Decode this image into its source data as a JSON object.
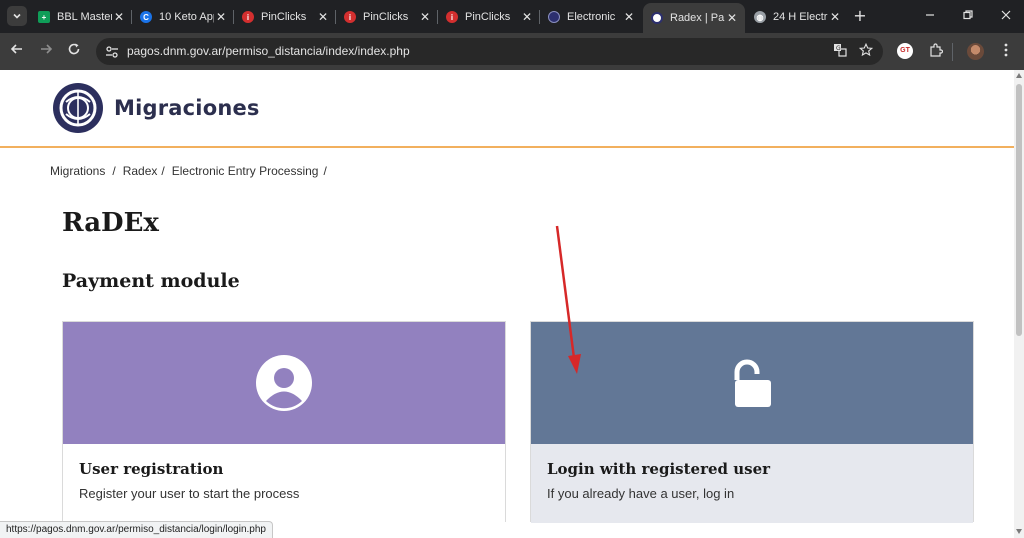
{
  "browser": {
    "tabs": [
      {
        "label": "BBL Master",
        "favicon": "sheets-icon",
        "color": "#0f9d58"
      },
      {
        "label": "10 Keto App",
        "favicon": "c-icon",
        "color": "#1a73e8"
      },
      {
        "label": "PinClicks",
        "favicon": "pinclicks-icon",
        "color": "#d32f2f"
      },
      {
        "label": "PinClicks",
        "favicon": "pinclicks-icon",
        "color": "#d32f2f"
      },
      {
        "label": "PinClicks",
        "favicon": "pinclicks-icon",
        "color": "#d32f2f"
      },
      {
        "label": "Electronic",
        "favicon": "dnm-icon",
        "color": "#2c2f6e"
      },
      {
        "label": "Radex | Pa",
        "favicon": "dnm-icon",
        "color": "#2c2f6e",
        "active": true
      },
      {
        "label": "24 H Electr",
        "favicon": "globe-icon",
        "color": "#9aa0a6"
      }
    ],
    "url": "pagos.dnm.gov.ar/permiso_distancia/index/index.php",
    "status_url": "https://pagos.dnm.gov.ar/permiso_distancia/login/login.php",
    "profile_badge": "GT"
  },
  "site": {
    "logo_text": "Migraciones",
    "accent_color": "#f2b05e"
  },
  "breadcrumb": [
    "Migrations",
    "Radex",
    "Electronic Entry Processing"
  ],
  "page_title": "RaDEx",
  "section_title": "Payment module",
  "cards": [
    {
      "title": "User registration",
      "description": "Register your user to start the process",
      "icon": "user-icon",
      "color": "#9281bf"
    },
    {
      "title": "Login with registered user",
      "description": "If you already have a user, log in",
      "icon": "unlock-icon",
      "color": "#627796"
    }
  ]
}
